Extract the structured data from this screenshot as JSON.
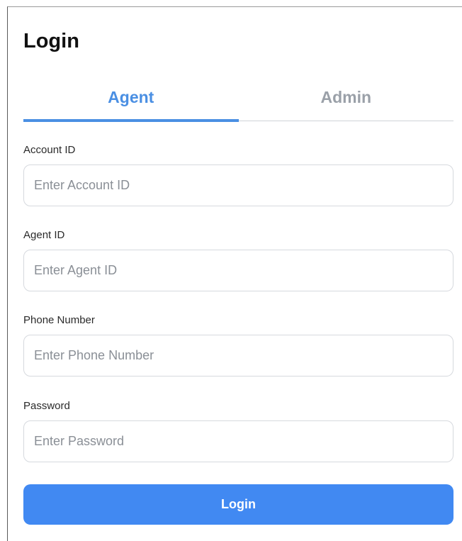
{
  "page": {
    "title": "Login"
  },
  "tabs": [
    {
      "label": "Agent",
      "active": true
    },
    {
      "label": "Admin",
      "active": false
    }
  ],
  "fields": {
    "account_id": {
      "label": "Account ID",
      "placeholder": "Enter Account ID",
      "value": ""
    },
    "agent_id": {
      "label": "Agent ID",
      "placeholder": "Enter Agent ID",
      "value": ""
    },
    "phone_number": {
      "label": "Phone Number",
      "placeholder": "Enter Phone Number",
      "value": ""
    },
    "password": {
      "label": "Password",
      "placeholder": "Enter Password",
      "value": ""
    }
  },
  "login_button": {
    "label": "Login"
  },
  "colors": {
    "accent": "#4a8fe3",
    "button": "#4189f2",
    "inactive_tab": "#9aa0a8",
    "input_border": "#d6d9de"
  }
}
